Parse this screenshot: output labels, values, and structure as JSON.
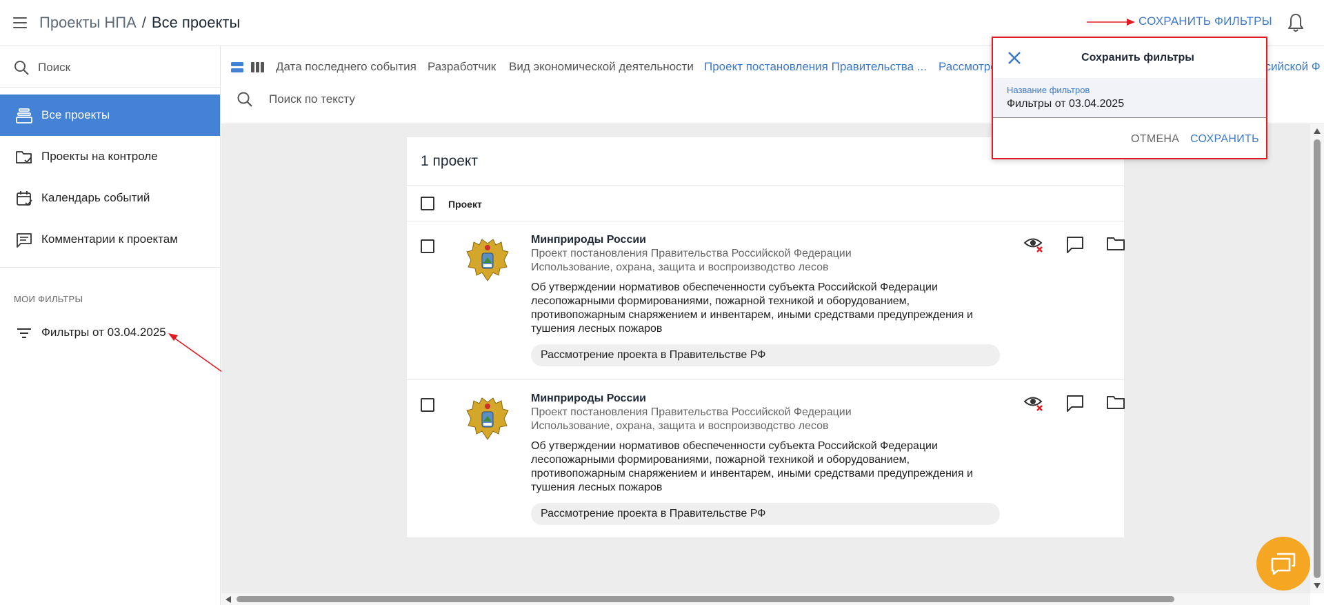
{
  "header": {
    "breadcrumb_parent": "Проекты НПА",
    "breadcrumb_sep": "/",
    "breadcrumb_current": "Все проекты",
    "save_filters_label": "СОХРАНИТЬ ФИЛЬТРЫ"
  },
  "sidebar": {
    "search_placeholder": "Поиск",
    "items": [
      {
        "label": "Все проекты",
        "icon": "stack-icon",
        "active": true
      },
      {
        "label": "Проекты на контроле",
        "icon": "folder-check-icon"
      },
      {
        "label": "Календарь событий",
        "icon": "calendar-check-icon"
      },
      {
        "label": "Комментарии к проектам",
        "icon": "comment-icon"
      }
    ],
    "section_title": "МОИ ФИЛЬТРЫ",
    "saved_filter": {
      "label": "Фильтры от 03.04.2025",
      "icon": "filter-lines-icon"
    }
  },
  "filterbar": {
    "tabs": [
      {
        "label": "Дата последнего события",
        "active": false
      },
      {
        "label": "Разработчик",
        "active": false
      },
      {
        "label": "Вид экономической деятельности",
        "active": false
      },
      {
        "label": "Проект постановления Правительства ...",
        "active": true
      },
      {
        "label": "Рассмотре",
        "active": true
      },
      {
        "label": "ссийской Ф",
        "active": true
      }
    ],
    "search_placeholder": "Поиск по тексту"
  },
  "list": {
    "count_label": "1 проект",
    "column_label": "Проект",
    "rows": [
      {
        "org": "Минприроды России",
        "type": "Проект постановления Правительства Российской Федерации",
        "area": "Использование, охрана, защита и воспроизводство лесов",
        "description": "Об утверждении нормативов обеспеченности субъекта Российской Федерации лесопожарными формированиями, пожарной техникой и оборудованием, противопожарным снаряжением и инвентарем, иными средствами предупреждения и тушения лесных пожаров",
        "stage": "Рассмотрение проекта в Правительстве РФ"
      },
      {
        "org": "Минприроды России",
        "type": "Проект постановления Правительства Российской Федерации",
        "area": "Использование, охрана, защита и воспроизводство лесов",
        "description": "Об утверждении нормативов обеспеченности субъекта Российской Федерации лесопожарными формированиями, пожарной техникой и оборудованием, противопожарным снаряжением и инвентарем, иными средствами предупреждения и тушения лесных пожаров",
        "stage": "Рассмотрение проекта в Правительстве РФ"
      }
    ]
  },
  "save_dialog": {
    "title": "Сохранить фильтры",
    "field_label": "Название фильтров",
    "field_value": "Фильтры от 03.04.2025",
    "cancel_label": "ОТМЕНА",
    "save_label": "СОХРАНИТЬ"
  },
  "colors": {
    "accent": "#4482d6",
    "link": "#3c79c8",
    "highlight_border": "#e01b24",
    "annotation_arrow": "#e01b24",
    "chat_button": "#f5a623"
  }
}
